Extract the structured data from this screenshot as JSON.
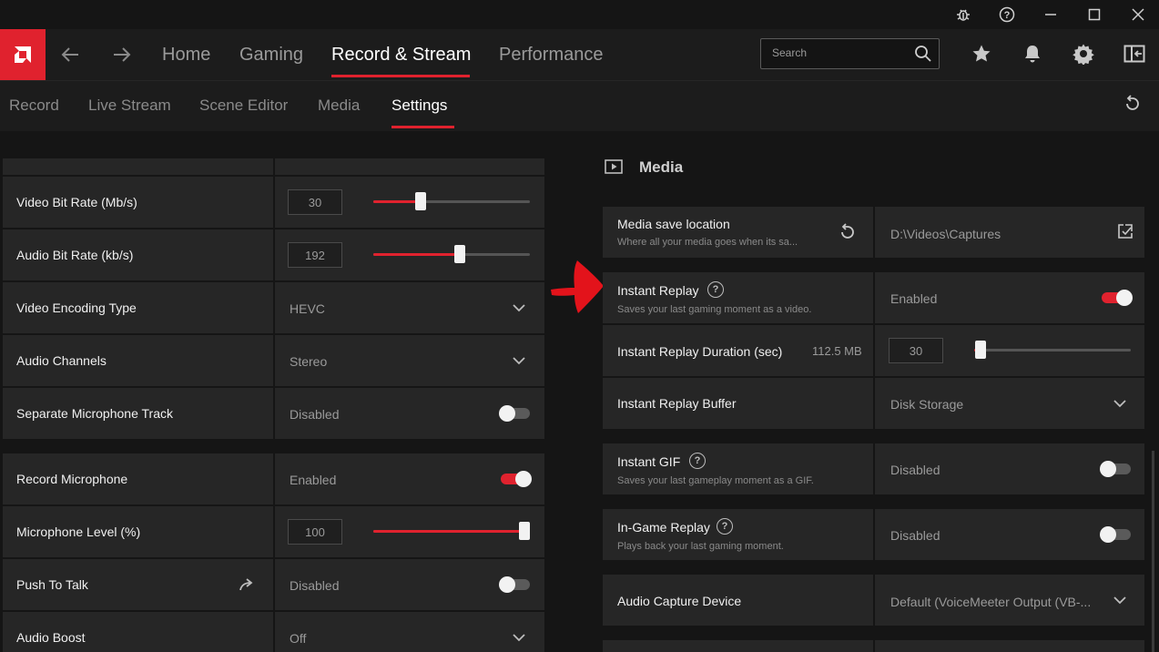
{
  "nav": {
    "tabs": [
      {
        "label": "Home"
      },
      {
        "label": "Gaming"
      },
      {
        "label": "Record & Stream"
      },
      {
        "label": "Performance"
      }
    ],
    "search_placeholder": "Search"
  },
  "subnav": {
    "tabs": [
      {
        "label": "Record"
      },
      {
        "label": "Live Stream"
      },
      {
        "label": "Scene Editor"
      },
      {
        "label": "Media"
      },
      {
        "label": "Settings"
      }
    ]
  },
  "left": {
    "video_bitrate": {
      "label": "Video Bit Rate (Mb/s)",
      "value": "30",
      "level": 0.3
    },
    "audio_bitrate": {
      "label": "Audio Bit Rate (kb/s)",
      "value": "192",
      "level": 0.55
    },
    "video_encoding": {
      "label": "Video Encoding Type",
      "value": "HEVC"
    },
    "audio_channels": {
      "label": "Audio Channels",
      "value": "Stereo"
    },
    "separate_mic": {
      "label": "Separate Microphone Track",
      "value": "Disabled",
      "on": false
    },
    "record_mic": {
      "label": "Record Microphone",
      "value": "Enabled",
      "on": true
    },
    "mic_level": {
      "label": "Microphone Level (%)",
      "value": "100",
      "level": 1.0
    },
    "push_to_talk": {
      "label": "Push To Talk",
      "value": "Disabled",
      "on": false
    },
    "audio_boost": {
      "label": "Audio Boost",
      "value": "Off"
    }
  },
  "right": {
    "section_title": "Media",
    "save_location": {
      "label": "Media save location",
      "desc": "Where all your media goes when its sa...",
      "value": "D:\\Videos\\Captures"
    },
    "instant_replay": {
      "label": "Instant Replay",
      "desc": "Saves your last gaming moment as a video.",
      "value": "Enabled",
      "on": true
    },
    "replay_duration": {
      "label": "Instant Replay Duration (sec)",
      "size": "112.5 MB",
      "value": "30",
      "level": 0.04
    },
    "replay_buffer": {
      "label": "Instant Replay Buffer",
      "value": "Disk Storage"
    },
    "instant_gif": {
      "label": "Instant GIF",
      "desc": "Saves your last gameplay moment as a GIF.",
      "value": "Disabled",
      "on": false
    },
    "ingame_replay": {
      "label": "In-Game Replay",
      "desc": "Plays back your last gaming moment.",
      "value": "Disabled",
      "on": false
    },
    "audio_capture": {
      "label": "Audio Capture Device",
      "value": "Default (VoiceMeeter Output (VB-..."
    }
  },
  "colors": {
    "accent": "#e0222e",
    "panel": "#262626",
    "background": "#151515"
  }
}
